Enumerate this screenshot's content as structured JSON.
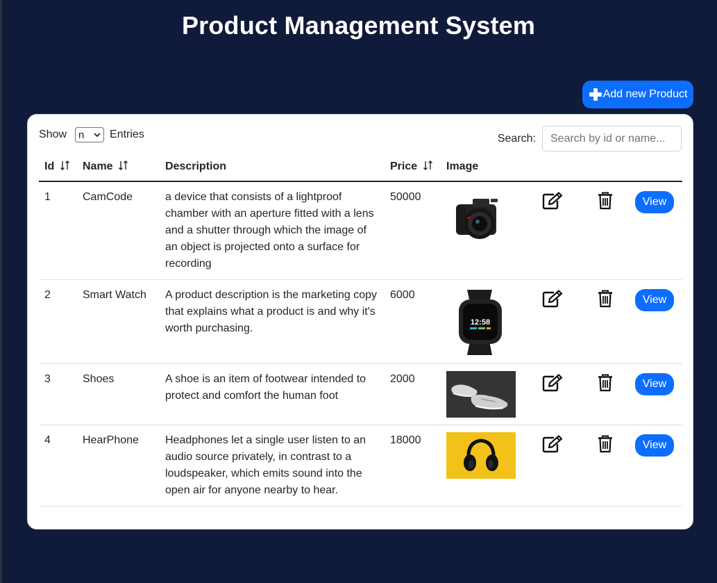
{
  "page": {
    "title": "Product Management System"
  },
  "toolbar": {
    "add_label": "Add new Product"
  },
  "controls": {
    "show_label": "Show",
    "entries_value": "n",
    "entries_label": "Entries",
    "search_label": "Search:",
    "search_placeholder": "Search by id or name..."
  },
  "table": {
    "headers": {
      "id": "Id",
      "name": "Name",
      "description": "Description",
      "price": "Price",
      "image": "Image"
    },
    "view_label": "View",
    "rows": [
      {
        "id": "1",
        "name": "CamCode",
        "description": "a device that consists of a lightproof chamber with an aperture fitted with a lens and a shutter through which the image of an object is projected onto a surface for recording",
        "price": "50000",
        "image": "camera-photo"
      },
      {
        "id": "2",
        "name": "Smart Watch",
        "description": "A product description is the marketing copy that explains what a product is and why it's worth purchasing.",
        "price": "6000",
        "image": "smartwatch-photo",
        "watch_time": "12:58"
      },
      {
        "id": "3",
        "name": "Shoes",
        "description": "A shoe is an item of footwear intended to protect and comfort the human foot",
        "price": "2000",
        "image": "shoes-photo"
      },
      {
        "id": "4",
        "name": "HearPhone",
        "description": "Headphones let a single user listen to an audio source privately, in contrast to a loudspeaker, which emits sound into the open air for anyone nearby to hear.",
        "price": "18000",
        "image": "headphones-photo"
      }
    ]
  },
  "colors": {
    "page_background": "#101a3a",
    "primary": "#0d6efd",
    "card": "#ffffff"
  }
}
